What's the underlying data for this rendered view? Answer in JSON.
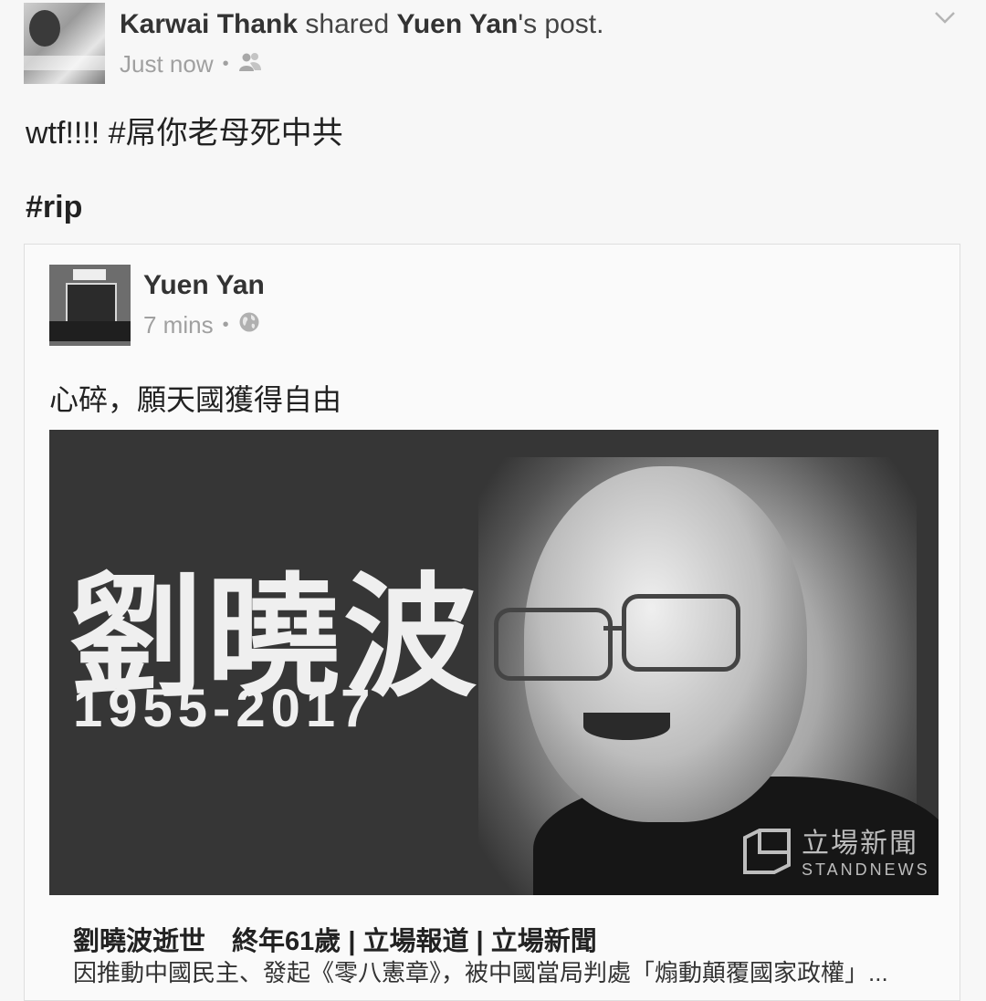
{
  "header": {
    "sharer_name": "Karwai Thank",
    "shared_word": "shared",
    "original_poster": "Yuen Yan",
    "post_suffix": "'s post.",
    "timestamp": "Just now",
    "audience_icon": "friends-icon",
    "menu_icon": "chevron-down-icon"
  },
  "post": {
    "text": "wtf!!!! #屌你老母死中共",
    "hashtag": "#rip"
  },
  "shared_post": {
    "author": "Yuen Yan",
    "timestamp": "7 mins",
    "audience_icon": "globe-icon",
    "text": "心碎，願天國獲得自由",
    "image": {
      "name": "劉曉波",
      "years": "1955-2017",
      "logo_zh": "立場新聞",
      "logo_en": "STANDNEWS"
    },
    "link": {
      "title": "劉曉波逝世　終年61歲 | 立場報道 | 立場新聞",
      "description": "因推動中國民主、發起《零八憲章》，被中國當局判處「煽動顛覆國家政權」..."
    }
  },
  "colors": {
    "background": "#f7f7f7",
    "text": "#222222",
    "muted": "#a0a0a0",
    "image_bg": "#363636"
  }
}
